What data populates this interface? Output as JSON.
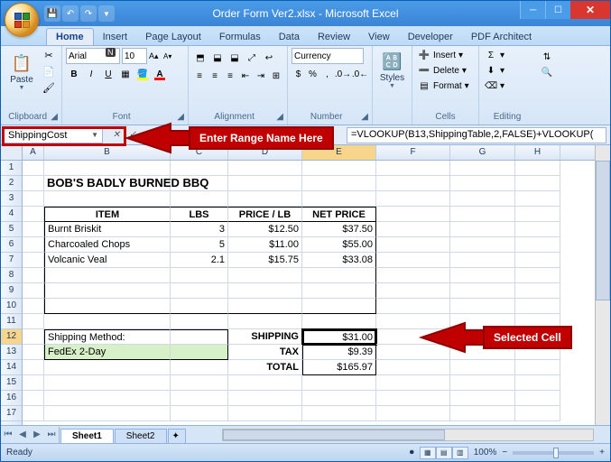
{
  "window": {
    "title": "Order Form Ver2.xlsx - Microsoft Excel"
  },
  "qat": {
    "save_tip": "Save",
    "undo_tip": "Undo",
    "redo_tip": "Redo"
  },
  "tabs": {
    "home": "Home",
    "insert": "Insert",
    "pagelayout": "Page Layout",
    "formulas": "Formulas",
    "data": "Data",
    "review": "Review",
    "view": "View",
    "developer": "Developer",
    "pdf": "PDF Architect"
  },
  "keytip_n": "N",
  "ribbon": {
    "clipboard": {
      "paste": "Paste",
      "label": "Clipboard"
    },
    "font": {
      "name": "Arial",
      "size": "10",
      "label": "Font"
    },
    "alignment": {
      "label": "Alignment"
    },
    "number": {
      "format": "Currency",
      "label": "Number"
    },
    "styles": {
      "styles": "Styles",
      "label": "Styles"
    },
    "cells": {
      "insert": "Insert",
      "delete": "Delete",
      "format": "Format",
      "label": "Cells"
    },
    "editing": {
      "label": "Editing"
    }
  },
  "namebox": "ShippingCost",
  "formula": "=VLOOKUP(B13,ShippingTable,2,FALSE)+VLOOKUP(",
  "callouts": {
    "namebox": "Enter Range Name Here",
    "selected": "Selected Cell"
  },
  "columns": [
    "A",
    "B",
    "C",
    "D",
    "E",
    "F",
    "G",
    "H"
  ],
  "sheet": {
    "title": "BOB'S BADLY BURNED BBQ",
    "headers": {
      "item": "ITEM",
      "lbs": "LBS",
      "price": "PRICE / LB",
      "net": "NET PRICE"
    },
    "rows": [
      {
        "item": "Burnt Briskit",
        "lbs": "3",
        "price": "$12.50",
        "net": "$37.50"
      },
      {
        "item": "Charcoaled Chops",
        "lbs": "5",
        "price": "$11.00",
        "net": "$55.00"
      },
      {
        "item": "Volcanic Veal",
        "lbs": "2.1",
        "price": "$15.75",
        "net": "$33.08"
      }
    ],
    "ship_label": "Shipping Method:",
    "ship_value": "FedEx 2-Day",
    "totals": {
      "shipping_l": "SHIPPING",
      "shipping_v": "$31.00",
      "tax_l": "TAX",
      "tax_v": "$9.39",
      "total_l": "TOTAL",
      "total_v": "$165.97"
    }
  },
  "sheets": {
    "s1": "Sheet1",
    "s2": "Sheet2"
  },
  "status": {
    "ready": "Ready",
    "rec": "",
    "zoom": "100%"
  }
}
